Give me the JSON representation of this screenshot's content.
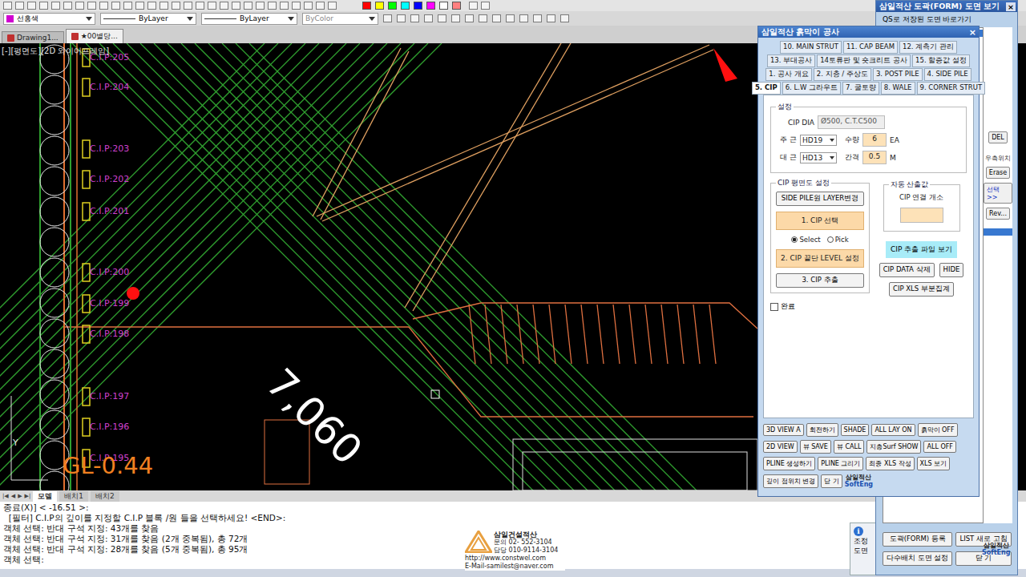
{
  "toolbar": {
    "swatches": [
      {
        "color": "#ff0000"
      },
      {
        "color": "#ffff00"
      },
      {
        "color": "#00ff00"
      },
      {
        "color": "#00ffff"
      },
      {
        "color": "#0000ff"
      },
      {
        "color": "#ff00ff"
      },
      {
        "color": "#ffffff"
      },
      {
        "color": "#ff8080"
      }
    ],
    "layer": "선홍색",
    "linetype": "ByLayer",
    "lineweight": "ByLayer",
    "plotstyle": "ByColor"
  },
  "doc_tabs": [
    {
      "label": "Drawing1...",
      "selected": false
    },
    {
      "label": "★00별당...",
      "selected": true
    }
  ],
  "viewport": {
    "label": "[-][평면도][2D 와이어프레임]"
  },
  "drawing": {
    "cip_labels": [
      "C.I.P:205",
      "C.I.P:204",
      "C.I.P:203",
      "C.I.P:202",
      "C.I.P:201",
      "C.I.P:200",
      "C.I.P:199",
      "C.I.P:198",
      "C.I.P:197",
      "C.I.P:196",
      "C.I.P:195"
    ],
    "dimension": "7,060",
    "ground_level": "GL-0.44",
    "axis_y": "Y"
  },
  "layout_tabs": {
    "nav": [
      "|◀",
      "◀",
      "▶",
      "▶|"
    ],
    "tabs": [
      {
        "label": "모델",
        "selected": true
      },
      {
        "label": "배치1",
        "selected": false
      },
      {
        "label": "배치2",
        "selected": false
      }
    ]
  },
  "command": {
    "lines": [
      "종료(X)] < -16.51 >:",
      "  [필터] C.I.P의 깊이를 지정할 C.I.P 블록 /원 들을 선택하세요! <END>:",
      "객체 선택: 반대 구석 지정: 43개를 찾음",
      "객체 선택: 반대 구석 지정: 31개를 찾음 (2개 중복됨), 총 72개",
      "객체 선택: 반대 구석 지정: 28개를 찾음 (5개 중복됨), 총 95개"
    ],
    "prompt": "객체 선택:"
  },
  "watermark": {
    "company": "삼일건설적산",
    "phone": "문의 02- 552-3104",
    "contact": "담당 010-9114-3104",
    "url": "http://www.constwel.com",
    "email": "E-Mail-samilest@naver.com"
  },
  "panel": {
    "title": "삼일적산 흙막이 공사",
    "close": "×",
    "tab_rows": [
      [
        {
          "label": "10. MAIN STRUT",
          "selected": false
        },
        {
          "label": "11. CAP BEAM",
          "selected": false
        },
        {
          "label": "12. 계측기 관리",
          "selected": false
        }
      ],
      [
        {
          "label": "13. 부대공사",
          "selected": false
        },
        {
          "label": "14토류판 및 숏크리트 공사",
          "selected": false
        },
        {
          "label": "15. 할증값 설정",
          "selected": false
        }
      ],
      [
        {
          "label": "1. 공사 개요",
          "selected": false
        },
        {
          "label": "2. 지층 / 주상도",
          "selected": false
        },
        {
          "label": "3. POST PILE",
          "selected": false
        },
        {
          "label": "4. SIDE PILE",
          "selected": false
        }
      ],
      [
        {
          "label": "5. CIP",
          "selected": true
        },
        {
          "label": "6. L.W 그라우트",
          "selected": false
        },
        {
          "label": "7. 굴토량",
          "selected": false
        },
        {
          "label": "8. WALE",
          "selected": false
        },
        {
          "label": "9. CORNER STRUT",
          "selected": false
        }
      ]
    ],
    "settings": {
      "legend": "설정",
      "dia_label": "CIP DIA",
      "dia_value": "Ø500, C.T.C500",
      "main_label": "주 근",
      "main_value": "HD19",
      "qty_label": "수량",
      "qty_value": "6",
      "qty_unit": "EA",
      "tie_label": "대 근",
      "tie_value": "HD13",
      "spacing_label": "간격",
      "spacing_value": "0.5",
      "spacing_unit": "M"
    },
    "plan": {
      "legend": "CIP 평면도 설정",
      "layer_button": "SIDE PILE원 LAYER변경",
      "step1": "1. CIP 선택",
      "modes": [
        {
          "label": "Select",
          "selected": true
        },
        {
          "label": "Pick",
          "selected": false
        }
      ],
      "step2": "2. CIP 끝단 LEVEL 설정",
      "step3": "3. CIP 추출"
    },
    "auto": {
      "legend": "자동 산출값",
      "label": "CIP 연결 개소",
      "value": ""
    },
    "actions": {
      "view_file": "CIP 추출 파일 보기",
      "delete": "CIP DATA 삭제",
      "hide": "HIDE",
      "xls": "CIP XLS 부분집계"
    },
    "done": {
      "label": "완료",
      "checked": false
    },
    "bottom_rows": [
      [
        "3D VIEW A",
        "회전하기",
        "SHADE",
        "ALL LAY ON",
        "흙막이 OFF"
      ],
      [
        "2D VIEW",
        "뷰 SAVE",
        "뷰 CALL",
        "지층Surf SHOW",
        "ALL OFF"
      ],
      [
        "PLINE 생성하기",
        "PLINE 그리기",
        "최종 XLS 작성",
        "XLS 보기"
      ],
      [
        "깊이 점위치 변경",
        "닫 기"
      ]
    ],
    "logo": [
      "삼일적산",
      "SoftEng"
    ]
  },
  "form_window": {
    "title": "삼일적산 도곽(FORM) 도면 보기",
    "close": "×",
    "shortcut_label": "QS로 저장된 도면 바로가기",
    "side": [
      {
        "label": "DEL",
        "kind": "button"
      },
      {
        "label": "우측위치",
        "kind": "text"
      },
      {
        "label": "Erase",
        "kind": "button"
      },
      {
        "label": "선택>>",
        "kind": "link"
      },
      {
        "label": "Rev...",
        "kind": "button"
      }
    ],
    "bottom_buttons": [
      "도곽(FORM) 등록",
      "LIST 새로 고침",
      "다수배치 도면 설정",
      "닫 기"
    ],
    "logo": [
      "삼일적산",
      "SoftEng"
    ]
  },
  "back_dialog": {
    "icon": "ℹ",
    "lines": [
      "조정",
      "도면"
    ]
  }
}
